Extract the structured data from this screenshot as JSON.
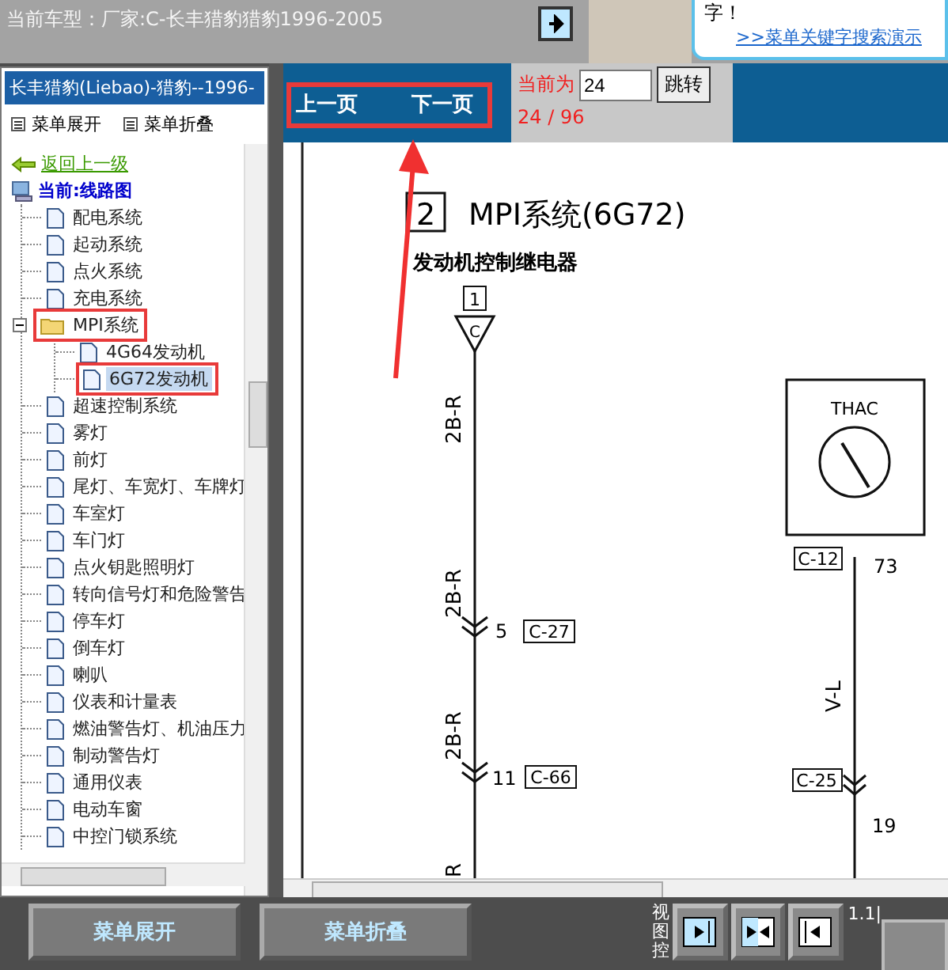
{
  "header": {
    "title": "当前车型：厂家:C-长丰猎豹猎豹1996-2005",
    "bubble_text": "字！",
    "bubble_link": ">>菜单关键字搜索演示"
  },
  "sidebar": {
    "title": "长丰猎豹(Liebao)-猎豹--1996-",
    "menu": [
      "菜单展开",
      "菜单折叠"
    ],
    "back": "返回上一级",
    "root": "当前:线路图",
    "items": [
      {
        "label": "配电系统",
        "selected": false,
        "highlighted": false
      },
      {
        "label": "起动系统",
        "selected": false,
        "highlighted": false
      },
      {
        "label": "点火系统",
        "selected": false,
        "highlighted": false
      },
      {
        "label": "充电系统",
        "selected": false,
        "highlighted": false
      },
      {
        "label": "MPI系统",
        "selected": false,
        "highlighted": true,
        "expanded": true,
        "children": [
          {
            "label": "4G64发动机",
            "selected": false,
            "highlighted": false
          },
          {
            "label": "6G72发动机",
            "selected": true,
            "highlighted": true
          }
        ]
      },
      {
        "label": "超速控制系统",
        "selected": false,
        "highlighted": false
      },
      {
        "label": "雾灯",
        "selected": false,
        "highlighted": false
      },
      {
        "label": "前灯",
        "selected": false,
        "highlighted": false
      },
      {
        "label": "尾灯、车宽灯、车牌灯",
        "selected": false,
        "highlighted": false
      },
      {
        "label": "车室灯",
        "selected": false,
        "highlighted": false
      },
      {
        "label": "车门灯",
        "selected": false,
        "highlighted": false
      },
      {
        "label": "点火钥匙照明灯",
        "selected": false,
        "highlighted": false
      },
      {
        "label": "转向信号灯和危险警告",
        "selected": false,
        "highlighted": false
      },
      {
        "label": "停车灯",
        "selected": false,
        "highlighted": false
      },
      {
        "label": "倒车灯",
        "selected": false,
        "highlighted": false
      },
      {
        "label": "喇叭",
        "selected": false,
        "highlighted": false
      },
      {
        "label": "仪表和计量表",
        "selected": false,
        "highlighted": false
      },
      {
        "label": "燃油警告灯、机油压力",
        "selected": false,
        "highlighted": false
      },
      {
        "label": "制动警告灯",
        "selected": false,
        "highlighted": false
      },
      {
        "label": "通用仪表",
        "selected": false,
        "highlighted": false
      },
      {
        "label": "电动车窗",
        "selected": false,
        "highlighted": false
      },
      {
        "label": "中控门锁系统",
        "selected": false,
        "highlighted": false
      }
    ]
  },
  "toolbar": {
    "prev": "上一页",
    "next": "下一页",
    "nav_highlighted": true,
    "current_label": "当前为",
    "page_input": "24",
    "jump_button": "跳转",
    "page_count": "24 / 96"
  },
  "diagram": {
    "section": "2",
    "title": "MPI系统(6G72)",
    "subtitle": "发动机控制继电器",
    "terminal": "1",
    "connector": "C",
    "wire_labels": [
      "2B-R",
      "2B-R",
      "2B-R"
    ],
    "wire_cut": "R",
    "pin_a": "5",
    "conn_a": "C-27",
    "pin_b": "11",
    "conn_b": "C-66",
    "sensor": "THAC",
    "conn_c": "C-12",
    "pin_c": "73",
    "wire_right": "V-L",
    "conn_d": "C-25",
    "pin_d": "19"
  },
  "footer": {
    "buttons": [
      "菜单展开",
      "菜单折叠"
    ],
    "view_label": "视图控",
    "zoom": "1.1|"
  }
}
